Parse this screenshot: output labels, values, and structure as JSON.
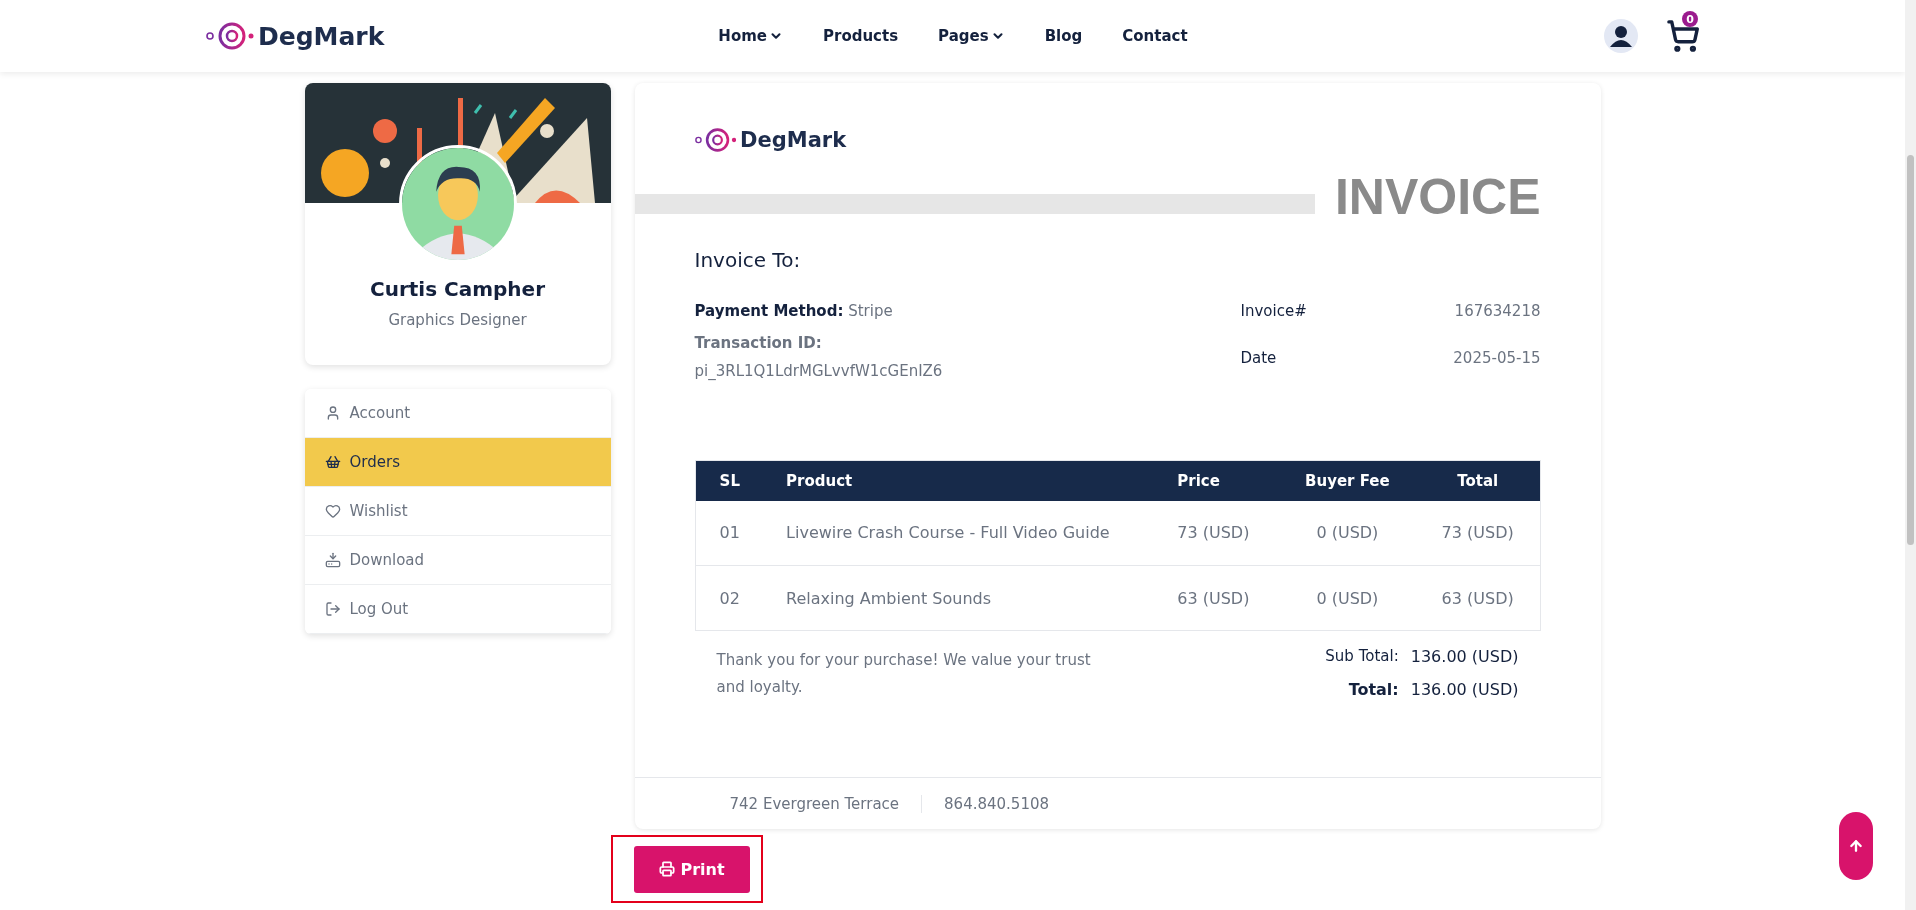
{
  "header": {
    "brand": "DegMark",
    "nav": [
      {
        "label": "Home",
        "dropdown": true
      },
      {
        "label": "Products",
        "dropdown": false
      },
      {
        "label": "Pages",
        "dropdown": true
      },
      {
        "label": "Blog",
        "dropdown": false
      },
      {
        "label": "Contact",
        "dropdown": false
      }
    ],
    "cart_count": "0"
  },
  "profile": {
    "name": "Curtis Campher",
    "role": "Graphics Designer"
  },
  "menu": [
    {
      "label": "Account",
      "kind": "user",
      "selected": false
    },
    {
      "label": "Orders",
      "kind": "basket",
      "selected": true
    },
    {
      "label": "Wishlist",
      "kind": "heart",
      "selected": false
    },
    {
      "label": "Download",
      "kind": "download",
      "selected": false
    },
    {
      "label": "Log Out",
      "kind": "logout",
      "selected": false
    }
  ],
  "invoice": {
    "brand": "DegMark",
    "title": "INVOICE",
    "to_heading": "Invoice To:",
    "payment_label": "Payment Method:",
    "payment_value": "Stripe",
    "transaction_label": "Transaction ID:",
    "transaction_value": "pi_3RL1Q1LdrMGLvvfW1cGEnIZ6",
    "meta": [
      {
        "label": "Invoice#",
        "value": "167634218"
      },
      {
        "label": "Date",
        "value": "2025-05-15"
      }
    ],
    "table": {
      "columns": [
        "SL",
        "Product",
        "Price",
        "Buyer Fee",
        "Total"
      ],
      "rows": [
        [
          "01",
          "Livewire Crash Course - Full Video Guide",
          "73 (USD)",
          "0 (USD)",
          "73 (USD)"
        ],
        [
          "02",
          "Relaxing Ambient Sounds",
          "63 (USD)",
          "0 (USD)",
          "63 (USD)"
        ]
      ]
    },
    "note": "Thank you for your purchase! We value your trust and loyalty.",
    "totals": [
      {
        "label": "Sub Total:",
        "value": "136.00 (USD)",
        "emphasis": false
      },
      {
        "label": "Total:",
        "value": "136.00 (USD)",
        "emphasis": true
      }
    ],
    "footer": [
      "742 Evergreen Terrace",
      "864.840.5108"
    ]
  },
  "print_button": "Print"
}
